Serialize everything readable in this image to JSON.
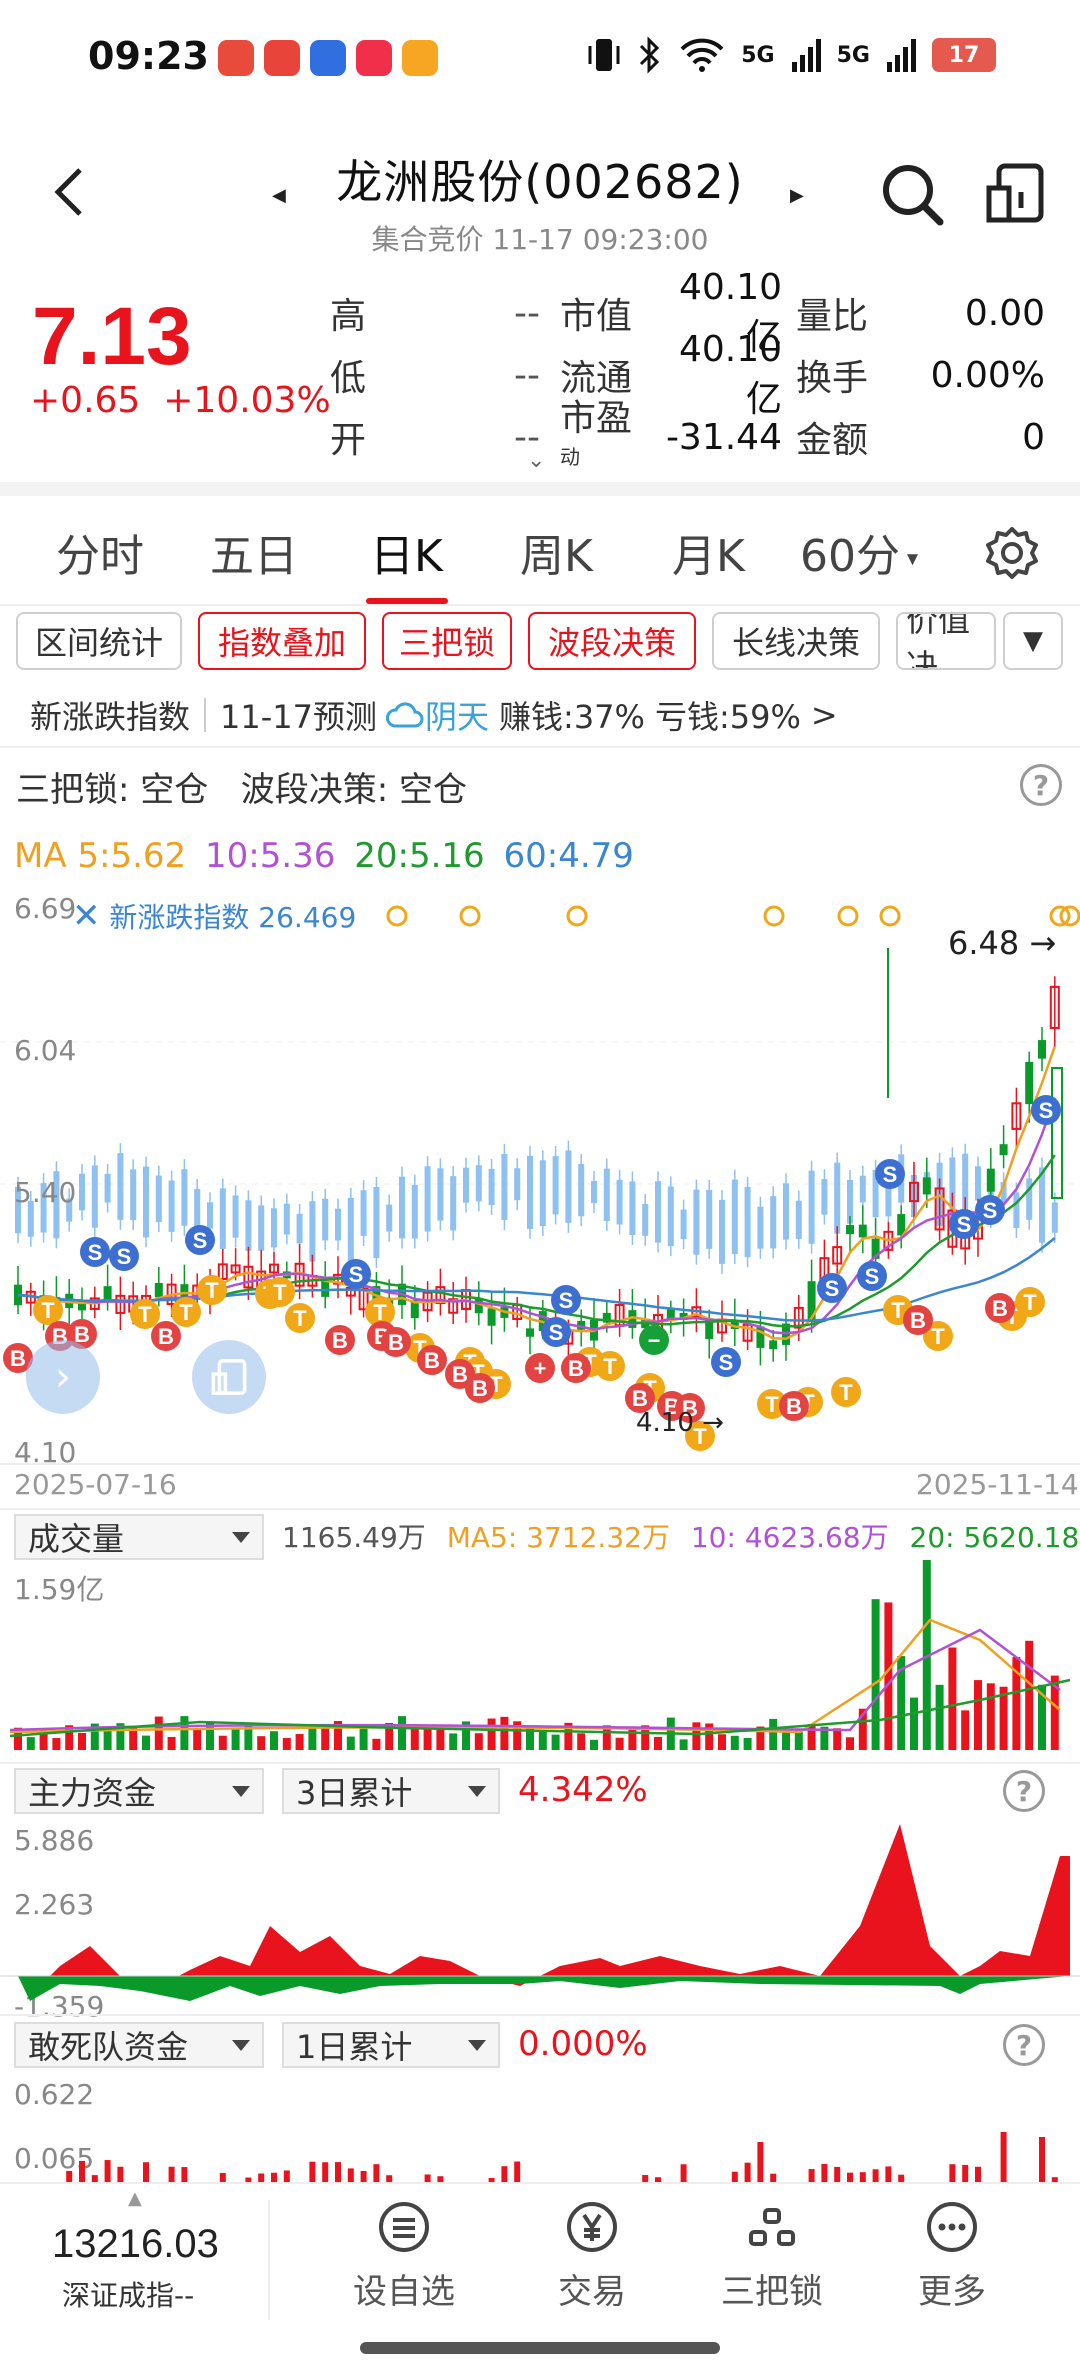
{
  "status_bar": {
    "time": "09:23",
    "network_1": "5G",
    "network_2": "5G",
    "battery": "17"
  },
  "header": {
    "title": "龙洲股份(002682)",
    "subtitle": "集合竞价 11-17 09:23:00"
  },
  "quote": {
    "price": "7.13",
    "change": "+0.65",
    "change_pct": "+10.03%",
    "rows": [
      {
        "l1": "高",
        "v1": "--",
        "l2": "市值",
        "v2": "40.10亿",
        "l3": "量比",
        "v3": "0.00"
      },
      {
        "l1": "低",
        "v1": "--",
        "l2": "流通",
        "v2": "40.10亿",
        "l3": "换手",
        "v3": "0.00%"
      },
      {
        "l1": "开",
        "v1": "--",
        "l2": "市盈",
        "l2_sup": "动",
        "v2": "-31.44",
        "l3": "金额",
        "v3": "0"
      }
    ]
  },
  "period_tabs": [
    "分时",
    "五日",
    "日K",
    "周K",
    "月K",
    "60分"
  ],
  "active_tab": "日K",
  "chips": [
    "区间统计",
    "指数叠加",
    "三把锁",
    "波段决策",
    "长线决策",
    "价值决"
  ],
  "info_row": {
    "index_name": "新涨跌指数",
    "forecast": "11-17预测",
    "weather": "阴天",
    "earn": "赚钱:37%",
    "lose": "亏钱:59%",
    "more": ">"
  },
  "lock_row": {
    "label1": "三把锁: 空仓",
    "label2": "波段决策: 空仓"
  },
  "ma_row": {
    "ma5": "MA 5:5.62",
    "ma10": "10:5.36",
    "ma20": "20:5.16",
    "ma60": "60:4.79"
  },
  "colors": {
    "up": "#e8131c",
    "down": "#0a9a2a",
    "ma5": "#f0a020",
    "ma10": "#b052d6",
    "ma20": "#1e9a2e",
    "ma60": "#3a86d0",
    "index_line": "#8ec0f0"
  },
  "kline": {
    "y_max_label": "6.69",
    "y_label_2": "6.04",
    "y_label_3": "5.40",
    "y_min_label": "4.10",
    "overlay_label": "新涨跌指数 26.469",
    "last_marker": "6.48",
    "low_marker": "4.10",
    "start_date": "2025-07-16",
    "end_date": "2025-11-14"
  },
  "volume": {
    "selector": "成交量",
    "value": "1165.49万",
    "ma5": "MA5: 3712.32万",
    "ma10": "10: 4623.68万",
    "ma20": "20: 5620.18万",
    "y_max": "1.59亿"
  },
  "main_fund": {
    "selector": "主力资金",
    "period": "3日累计",
    "value": "4.342%",
    "y_max": "5.886",
    "y_mid": "2.263",
    "y_min": "-1.359"
  },
  "dare_fund": {
    "selector": "敢死队资金",
    "period": "1日累计",
    "value": "0.000%",
    "y_max": "0.622",
    "y_mid": "0.065"
  },
  "bottom_nav": {
    "index_value": "13216.03",
    "index_name": "深证成指--",
    "buttons": [
      "设自选",
      "交易",
      "三把锁",
      "更多"
    ]
  }
}
